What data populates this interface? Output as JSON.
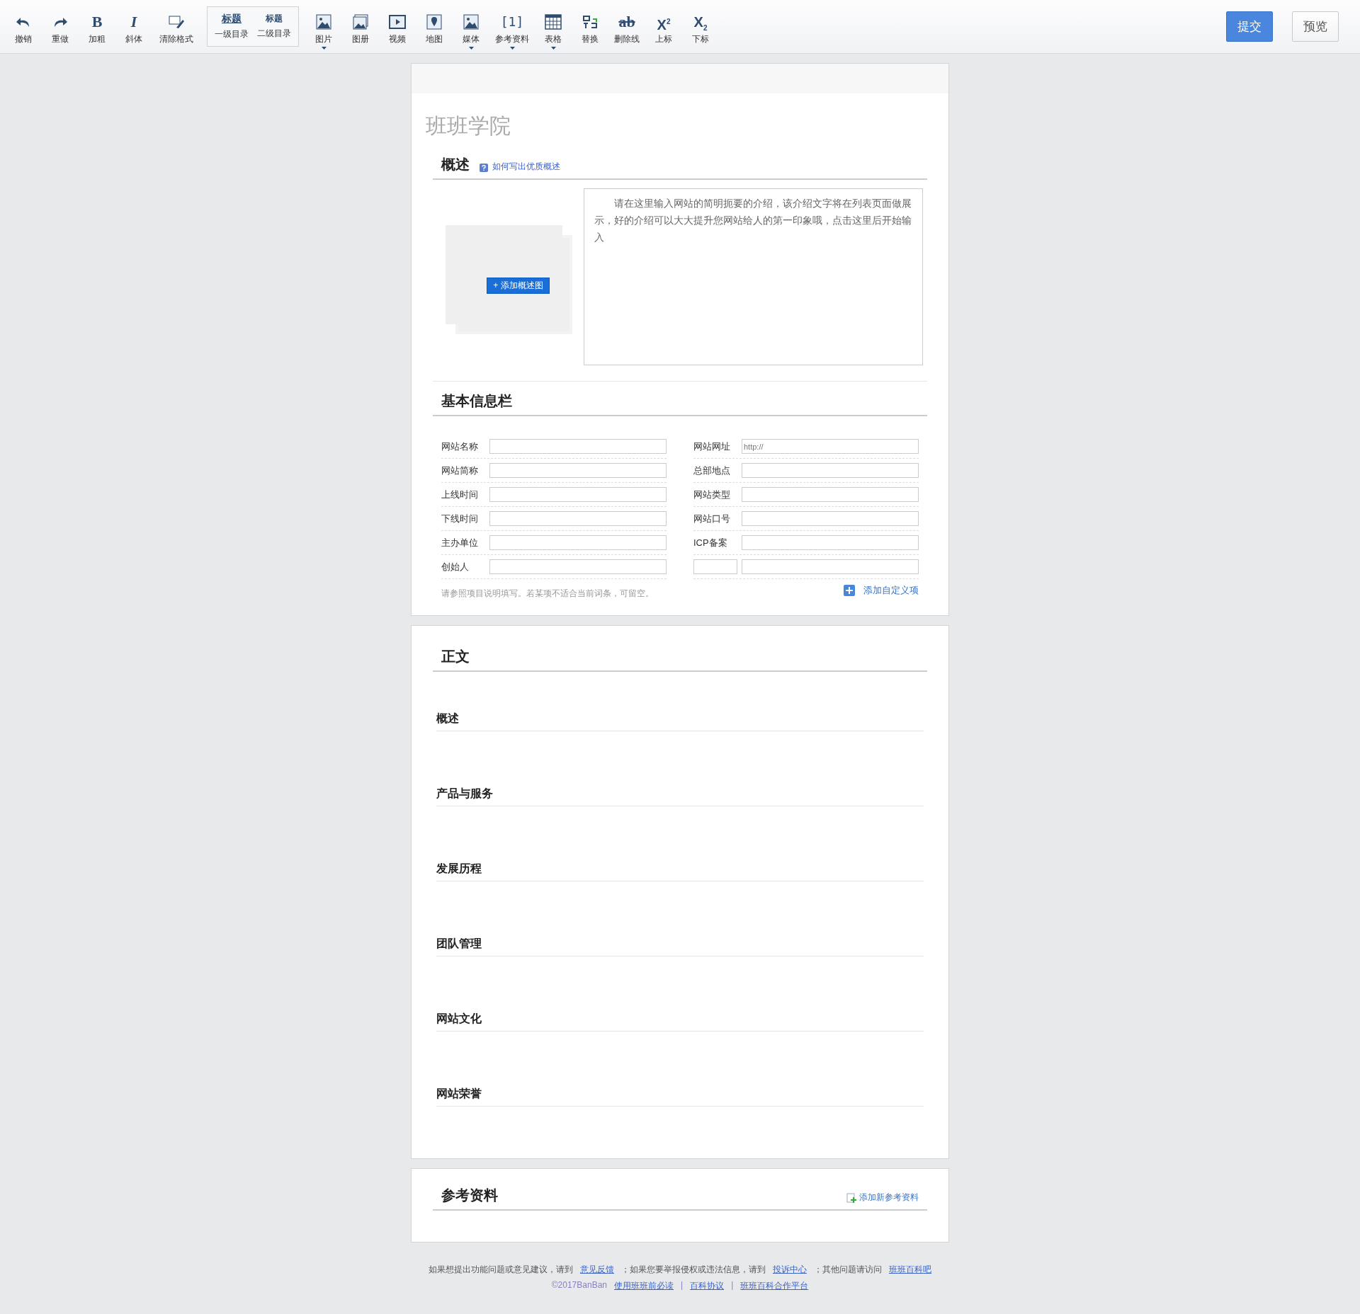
{
  "toolbar": {
    "tools": [
      {
        "kind": "icon",
        "label": "撤销",
        "dropdown": false
      },
      {
        "kind": "icon",
        "label": "重做",
        "dropdown": false
      },
      {
        "kind": "glyph",
        "glyph": "B",
        "label": "加粗",
        "dropdown": false
      },
      {
        "kind": "glyph",
        "glyph": "I",
        "label": "斜体",
        "dropdown": false
      },
      {
        "kind": "icon",
        "label": "清除格式",
        "dropdown": false
      },
      {
        "kind": "heading_group",
        "items": [
          {
            "sample": "标题",
            "label": "一级目录"
          },
          {
            "sample": "标题",
            "label": "二级目录"
          }
        ]
      },
      {
        "kind": "icon",
        "label": "图片",
        "dropdown": true
      },
      {
        "kind": "icon",
        "label": "图册",
        "dropdown": false
      },
      {
        "kind": "icon",
        "label": "视频",
        "dropdown": false
      },
      {
        "kind": "icon",
        "label": "地图",
        "dropdown": false
      },
      {
        "kind": "icon",
        "label": "媒体",
        "dropdown": true
      },
      {
        "kind": "glyph",
        "glyph": "[1]",
        "label": "参考资料",
        "dropdown": true
      },
      {
        "kind": "icon",
        "label": "表格",
        "dropdown": true
      },
      {
        "kind": "icon",
        "label": "替换",
        "dropdown": false
      },
      {
        "kind": "glyph",
        "glyph": "ab",
        "label": "删除线",
        "dropdown": false
      },
      {
        "kind": "glyph",
        "glyph": "X$^{2}$",
        "label": "上标",
        "dropdown": false
      },
      {
        "kind": "glyph",
        "glyph": "X$_{2}$",
        "label": "下标",
        "dropdown": false
      }
    ],
    "submit_button": "提交",
    "preview_button": "预览"
  },
  "editor": {
    "title": "班班学院",
    "summary": {
      "heading": "概述",
      "help_link": "如何写出优质概述",
      "add_image_button": "+ 添加概述图",
      "description_placeholder": "请在这里输入网站的简明扼要的介绍，该介绍文字将在列表页面做展示，好的介绍可以大大提升您网站给人的第一印象哦，点击这里后开始输入"
    },
    "basic_info": {
      "heading": "基本信息栏",
      "left_fields": [
        {
          "label": "网站名称"
        },
        {
          "label": "网站简称"
        },
        {
          "label": "上线时间"
        },
        {
          "label": "下线时间"
        },
        {
          "label": "主办单位"
        },
        {
          "label": "创始人"
        }
      ],
      "right_fields": [
        {
          "kind": "labeled",
          "label": "网站网址",
          "value": "http://"
        },
        {
          "kind": "labeled",
          "label": "总部地点"
        },
        {
          "kind": "labeled",
          "label": "网站类型"
        },
        {
          "kind": "labeled",
          "label": "网站口号"
        },
        {
          "kind": "labeled",
          "label": "ICP备案"
        },
        {
          "kind": "custom"
        }
      ],
      "hint": "请参照项目说明填写。若某项不适合当前词条，可留空。",
      "add_custom_button": "添加自定义项"
    },
    "body": {
      "heading": "正文",
      "sections": [
        "概述",
        "产品与服务",
        "发展历程",
        "团队管理",
        "网站文化",
        "网站荣誉"
      ]
    },
    "references": {
      "heading": "参考资料",
      "add_button": "添加新参考资料"
    }
  },
  "footer": {
    "line_1": [
      {
        "kind": "text",
        "text": "如果想提出功能问题或意见建议，请到"
      },
      {
        "kind": "link",
        "text": "意见反馈"
      },
      {
        "kind": "text",
        "text": "；如果您要举报侵权或违法信息，请到"
      },
      {
        "kind": "link",
        "text": "投诉中心"
      },
      {
        "kind": "text",
        "text": "；其他问题请访问"
      },
      {
        "kind": "link",
        "text": "班班百科吧"
      }
    ],
    "line_2": [
      {
        "kind": "copyright",
        "text": "©2017BanBan"
      },
      {
        "kind": "link",
        "text": "使用班班前必读"
      },
      {
        "kind": "separator",
        "text": "|"
      },
      {
        "kind": "link",
        "text": "百科协议"
      },
      {
        "kind": "separator",
        "text": "|"
      },
      {
        "kind": "link",
        "text": "班班百科合作平台"
      }
    ]
  }
}
